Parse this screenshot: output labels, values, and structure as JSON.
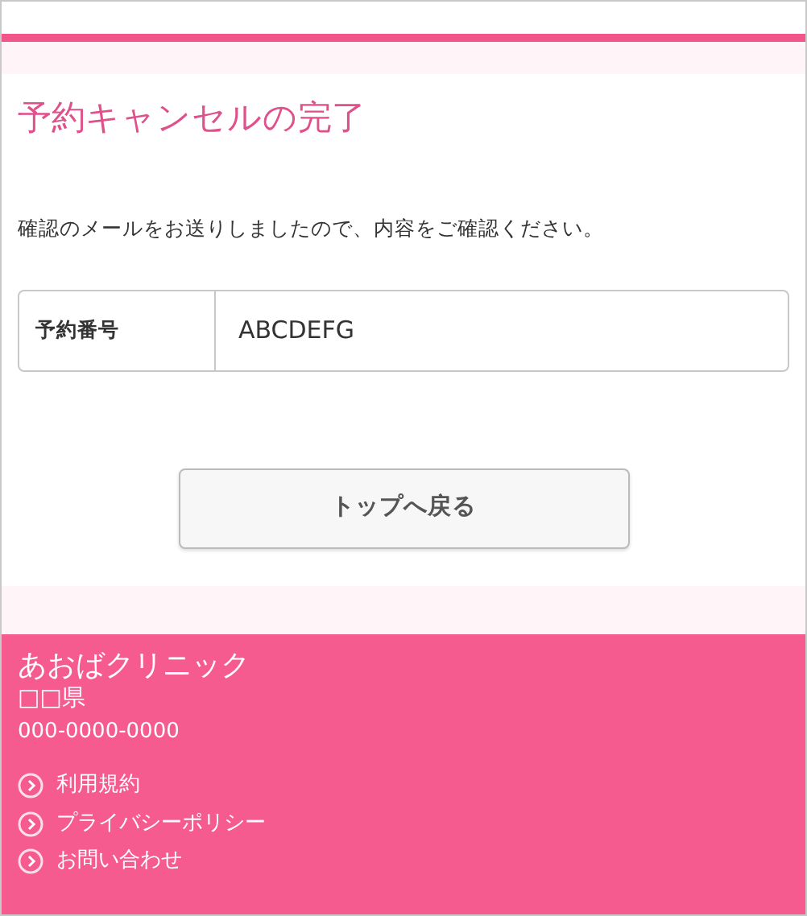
{
  "heading": "予約キャンセルの完了",
  "message": "確認のメールをお送りしましたので、内容をご確認ください。",
  "reservation": {
    "label": "予約番号",
    "value": "ABCDEFG"
  },
  "button": "トップへ戻る",
  "footer": {
    "clinic": "あおばクリニック",
    "prefecture": "□□県",
    "phone": "000-0000-0000",
    "links": [
      "利用規約",
      "プライバシーポリシー",
      "お問い合わせ"
    ]
  }
}
